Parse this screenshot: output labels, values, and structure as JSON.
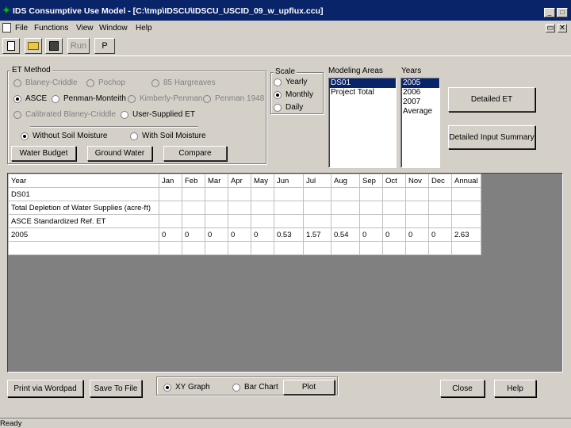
{
  "window": {
    "title": "IDS Consumptive Use Model - [C:\\tmp\\IDSCU\\IDSCU_USCID_09_w_upflux.ccu]",
    "minimize": "_",
    "maximize": "□",
    "close": "✕"
  },
  "menu": [
    "File",
    "Functions",
    "View",
    "Window",
    "Help"
  ],
  "toolbar": {
    "run_label": "Run",
    "p_label": "P"
  },
  "et_method": {
    "title": "ET Method",
    "options": [
      {
        "label": "Blaney-Criddle",
        "enabled": false,
        "selected": false
      },
      {
        "label": "Pochop",
        "enabled": false,
        "selected": false
      },
      {
        "label": "85 Hargreaves",
        "enabled": false,
        "selected": false
      },
      {
        "label": "ASCE",
        "enabled": true,
        "selected": true
      },
      {
        "label": "Penman-Monteith",
        "enabled": true,
        "selected": false
      },
      {
        "label": "Kimberly-Penman",
        "enabled": false,
        "selected": false
      },
      {
        "label": "Penman 1948",
        "enabled": false,
        "selected": false
      },
      {
        "label": "Calibrated Blaney-Criddle",
        "enabled": false,
        "selected": false
      },
      {
        "label": "User-Supplied ET",
        "enabled": true,
        "selected": false
      }
    ],
    "moisture": [
      {
        "label": "Without Soil Moisture",
        "selected": true
      },
      {
        "label": "With Soil Moisture",
        "selected": false
      }
    ],
    "buttons": [
      "Water Budget",
      "Ground Water",
      "Compare"
    ]
  },
  "scale": {
    "title": "Scale",
    "options": [
      {
        "label": "Yearly",
        "selected": false
      },
      {
        "label": "Monthly",
        "selected": true
      },
      {
        "label": "Daily",
        "selected": false
      }
    ]
  },
  "modeling_areas": {
    "title": "Modeling Areas",
    "items": [
      {
        "label": "DS01",
        "selected": true
      },
      {
        "label": "Project Total",
        "selected": false
      }
    ]
  },
  "years": {
    "title": "Years",
    "items": [
      {
        "label": "2005",
        "selected": true
      },
      {
        "label": "2006",
        "selected": false
      },
      {
        "label": "2007",
        "selected": false
      },
      {
        "label": "Average",
        "selected": false
      }
    ]
  },
  "side_buttons": {
    "detailed_et": "Detailed ET",
    "detailed_input": "Detailed Input Summary"
  },
  "table": {
    "headers": [
      "Year",
      "Jan",
      "Feb",
      "Mar",
      "Apr",
      "May",
      "Jun",
      "Jul",
      "Aug",
      "Sep",
      "Oct",
      "Nov",
      "Dec",
      "Annual"
    ],
    "rows": [
      [
        "DS01",
        "",
        "",
        "",
        "",
        "",
        "",
        "",
        "",
        "",
        "",
        "",
        "",
        ""
      ],
      [
        "Total Depletion of Water Supplies (acre-ft)",
        "",
        "",
        "",
        "",
        "",
        "",
        "",
        "",
        "",
        "",
        "",
        "",
        ""
      ],
      [
        "ASCE Standardized Ref. ET",
        "",
        "",
        "",
        "",
        "",
        "",
        "",
        "",
        "",
        "",
        "",
        "",
        ""
      ],
      [
        "2005",
        "0",
        "0",
        "0",
        "0",
        "0",
        "0.53",
        "1.57",
        "0.54",
        "0",
        "0",
        "0",
        "0",
        "2.63"
      ],
      [
        "",
        "",
        "",
        "",
        "",
        "",
        "",
        "",
        "",
        "",
        "",
        "",
        "",
        ""
      ]
    ]
  },
  "bottom": {
    "print_wordpad": "Print via Wordpad",
    "save_to_file": "Save To File",
    "graph_options": [
      {
        "label": "XY Graph",
        "selected": true
      },
      {
        "label": "Bar Chart",
        "selected": false
      }
    ],
    "plot": "Plot",
    "close": "Close",
    "help": "Help"
  },
  "status": "Ready"
}
